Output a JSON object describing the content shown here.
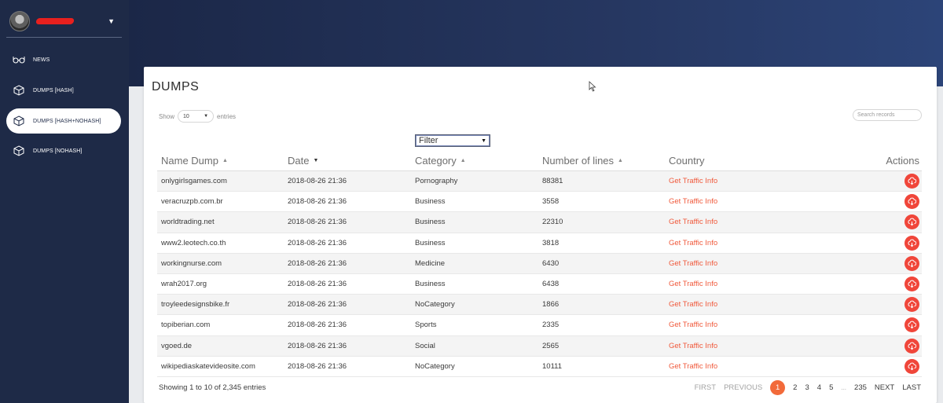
{
  "sidebar": {
    "items": [
      {
        "label": "NEWS",
        "icon": "glasses-icon"
      },
      {
        "label": "DUMPS [HASH]",
        "icon": "box-icon"
      },
      {
        "label": "DUMPS [HASH+NOHASH]",
        "icon": "box-icon"
      },
      {
        "label": "DUMPS [NOHASH]",
        "icon": "box-icon"
      }
    ],
    "active_index": 2
  },
  "page": {
    "title": "DUMPS"
  },
  "controls": {
    "show_label": "Show",
    "entries_label": "entries",
    "length_value": "10",
    "search_placeholder": "Search records",
    "filter_value": "Filter"
  },
  "table": {
    "columns": [
      "Name Dump",
      "Date",
      "Category",
      "Number of lines",
      "Country",
      "Actions"
    ],
    "country_link_label": "Get Traffic Info",
    "rows": [
      {
        "name": "onlygirlsgames.com",
        "date": "2018-08-26 21:36",
        "category": "Pornography",
        "lines": "88381"
      },
      {
        "name": "veracruzpb.com.br",
        "date": "2018-08-26 21:36",
        "category": "Business",
        "lines": "3558"
      },
      {
        "name": "worldtrading.net",
        "date": "2018-08-26 21:36",
        "category": "Business",
        "lines": "22310"
      },
      {
        "name": "www2.leotech.co.th",
        "date": "2018-08-26 21:36",
        "category": "Business",
        "lines": "3818"
      },
      {
        "name": "workingnurse.com",
        "date": "2018-08-26 21:36",
        "category": "Medicine",
        "lines": "6430"
      },
      {
        "name": "wrah2017.org",
        "date": "2018-08-26 21:36",
        "category": "Business",
        "lines": "6438"
      },
      {
        "name": "troyleedesignsbike.fr",
        "date": "2018-08-26 21:36",
        "category": "NoCategory",
        "lines": "1866"
      },
      {
        "name": "topiberian.com",
        "date": "2018-08-26 21:36",
        "category": "Sports",
        "lines": "2335"
      },
      {
        "name": "vgoed.de",
        "date": "2018-08-26 21:36",
        "category": "Social",
        "lines": "2565"
      },
      {
        "name": "wikipediaskatevideosite.com",
        "date": "2018-08-26 21:36",
        "category": "NoCategory",
        "lines": "10111"
      }
    ]
  },
  "footer": {
    "info": "Showing 1 to 10 of 2,345 entries",
    "pager": {
      "first": "FIRST",
      "previous": "PREVIOUS",
      "pages": [
        "1",
        "2",
        "3",
        "4",
        "5"
      ],
      "ellipsis": "...",
      "last_page": "235",
      "next": "NEXT",
      "last": "LAST",
      "current": "1"
    }
  },
  "colors": {
    "sidebar_bg": "#1e2a47",
    "accent": "#f05a3c",
    "action_button": "#f0463a"
  }
}
